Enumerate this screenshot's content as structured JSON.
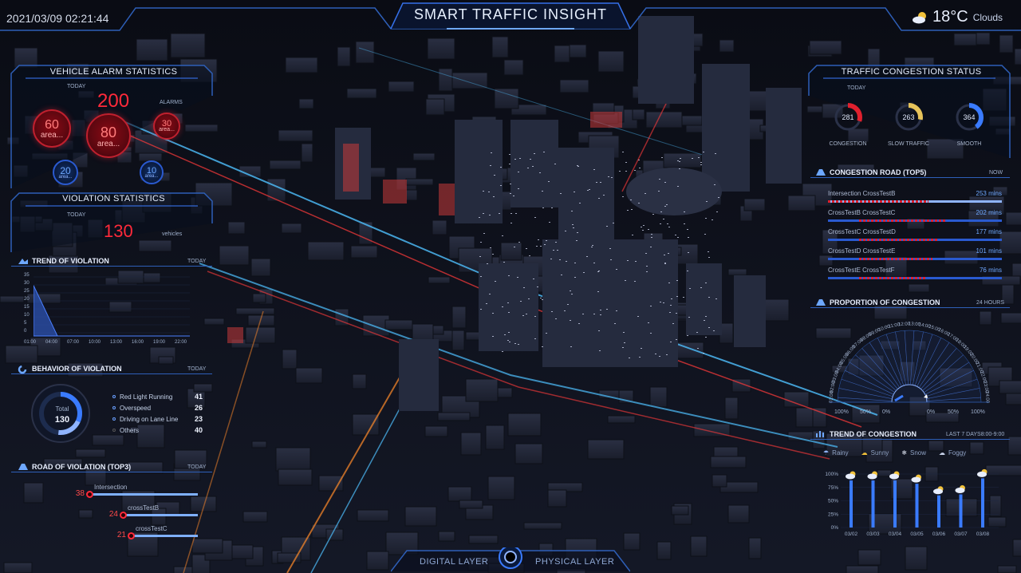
{
  "header": {
    "title": "SMART TRAFFIC INSIGHT",
    "datetime": "2021/03/09 02:21:44",
    "temperature": "18°C",
    "condition": "Clouds"
  },
  "vehicle_alarm": {
    "title": "VEHICLE ALARM STATISTICS",
    "today_label": "TODAY",
    "total": "200",
    "alarms_label": "ALARMS",
    "bubbles": [
      {
        "value": "60",
        "unit": "area..."
      },
      {
        "value": "80",
        "unit": "area..."
      },
      {
        "value": "30",
        "unit": "area..."
      },
      {
        "value": "20",
        "unit": "area..."
      },
      {
        "value": "10",
        "unit": "area..."
      }
    ]
  },
  "violation_stats": {
    "title": "VIOLATION STATISTICS",
    "today_label": "TODAY",
    "value": "130",
    "unit": "vehicles"
  },
  "trend_violation": {
    "title": "TREND OF VIOLATION",
    "period": "TODAY",
    "y_ticks": [
      "35",
      "30",
      "25",
      "20",
      "15",
      "10",
      "5",
      "0"
    ],
    "x_ticks": [
      "01:00",
      "04:00",
      "07:00",
      "10:00",
      "13:00",
      "16:00",
      "19:00",
      "22:00"
    ]
  },
  "behavior_violation": {
    "title": "BEHAVIOR OF VIOLATION",
    "period": "TODAY",
    "total_label": "Total",
    "total_value": "130",
    "items": [
      {
        "label": "Red Light Running",
        "value": "41"
      },
      {
        "label": "Overspeed",
        "value": "26"
      },
      {
        "label": "Driving on Lane Line",
        "value": "23"
      },
      {
        "label": "Others",
        "value": "40"
      }
    ]
  },
  "road_violation": {
    "title": "ROAD OF VIOLATION (TOP3)",
    "period": "TODAY",
    "items": [
      {
        "name": "Intersection",
        "value": "38",
        "fraction": 1.0
      },
      {
        "name": "crossTestB",
        "value": "24",
        "fraction": 0.63
      },
      {
        "name": "crossTestC",
        "value": "21",
        "fraction": 0.55
      }
    ]
  },
  "congestion_status": {
    "title": "TRAFFIC CONGESTION STATUS",
    "today_label": "TODAY",
    "items": [
      {
        "label": "CONGESTION",
        "value": "281",
        "fraction": 0.3,
        "color": "#e0202e"
      },
      {
        "label": "SLOW TRAFFIC",
        "value": "263",
        "fraction": 0.28,
        "color": "#e6c35a"
      },
      {
        "label": "SMOOTH",
        "value": "364",
        "fraction": 0.4,
        "color": "#3a7bff"
      }
    ]
  },
  "congestion_road": {
    "title": "CONGESTION ROAD (TOP5)",
    "period": "NOW",
    "items": [
      {
        "from": "Intersection",
        "to": "CrossTestB",
        "mins": "253 mins",
        "fraction": 0.58
      },
      {
        "from": "CrossTestB",
        "to": "CrossTestC",
        "mins": "202 mins",
        "fraction": 0.5
      },
      {
        "from": "CrossTestC",
        "to": "CrossTestD",
        "mins": "177 mins",
        "fraction": 0.45
      },
      {
        "from": "CrossTestD",
        "to": "CrossTestE",
        "mins": "101 mins",
        "fraction": 0.42
      },
      {
        "from": "CrossTestE",
        "to": "CrossTestF",
        "mins": "76 mins",
        "fraction": 0.38
      }
    ]
  },
  "proportion_congestion": {
    "title": "PROPORTION OF CONGESTION",
    "period": "24 HOURS",
    "hours": [
      "01:00",
      "02:00",
      "03:00",
      "04:00",
      "05:00",
      "06:00",
      "07:00",
      "08:00",
      "09:00",
      "10:00",
      "11:00",
      "12:00",
      "13:00",
      "14:00",
      "15:00",
      "16:00",
      "17:00",
      "18:00",
      "19:00",
      "20:00",
      "21:00",
      "22:00",
      "23:00",
      "24:00"
    ],
    "axis_labels": [
      "100%",
      "50%",
      "0%",
      "0%",
      "50%",
      "100%"
    ]
  },
  "trend_congestion": {
    "title": "TREND OF CONGESTION",
    "period": "LAST 7 DAYS8:00-9:00",
    "legend": [
      "Rainy",
      "Sunny",
      "Snow",
      "Foggy"
    ],
    "y_ticks": [
      "100%",
      "75%",
      "50%",
      "25%",
      "0%"
    ]
  },
  "footer": {
    "digital": "DIGITAL LAYER",
    "physical": "PHYSICAL LAYER"
  },
  "chart_data": [
    {
      "type": "area",
      "title": "TREND OF VIOLATION",
      "x": [
        "01:00",
        "04:00",
        "07:00",
        "10:00",
        "13:00",
        "16:00",
        "19:00",
        "22:00"
      ],
      "series": [
        {
          "values": [
            30,
            0,
            0,
            0,
            0,
            0,
            0,
            0
          ]
        }
      ],
      "ylim": [
        0,
        35
      ]
    },
    {
      "type": "bar",
      "title": "TREND OF CONGESTION",
      "categories": [
        "03/02",
        "03/03",
        "03/04",
        "03/05",
        "03/06",
        "03/07",
        "03/08"
      ],
      "values": [
        88,
        88,
        88,
        82,
        60,
        62,
        92
      ],
      "ylim": [
        0,
        100
      ]
    }
  ],
  "colors": {
    "accent": "#3a7bff",
    "alert": "#e0202e",
    "panel_border": "#2e5fb8"
  }
}
